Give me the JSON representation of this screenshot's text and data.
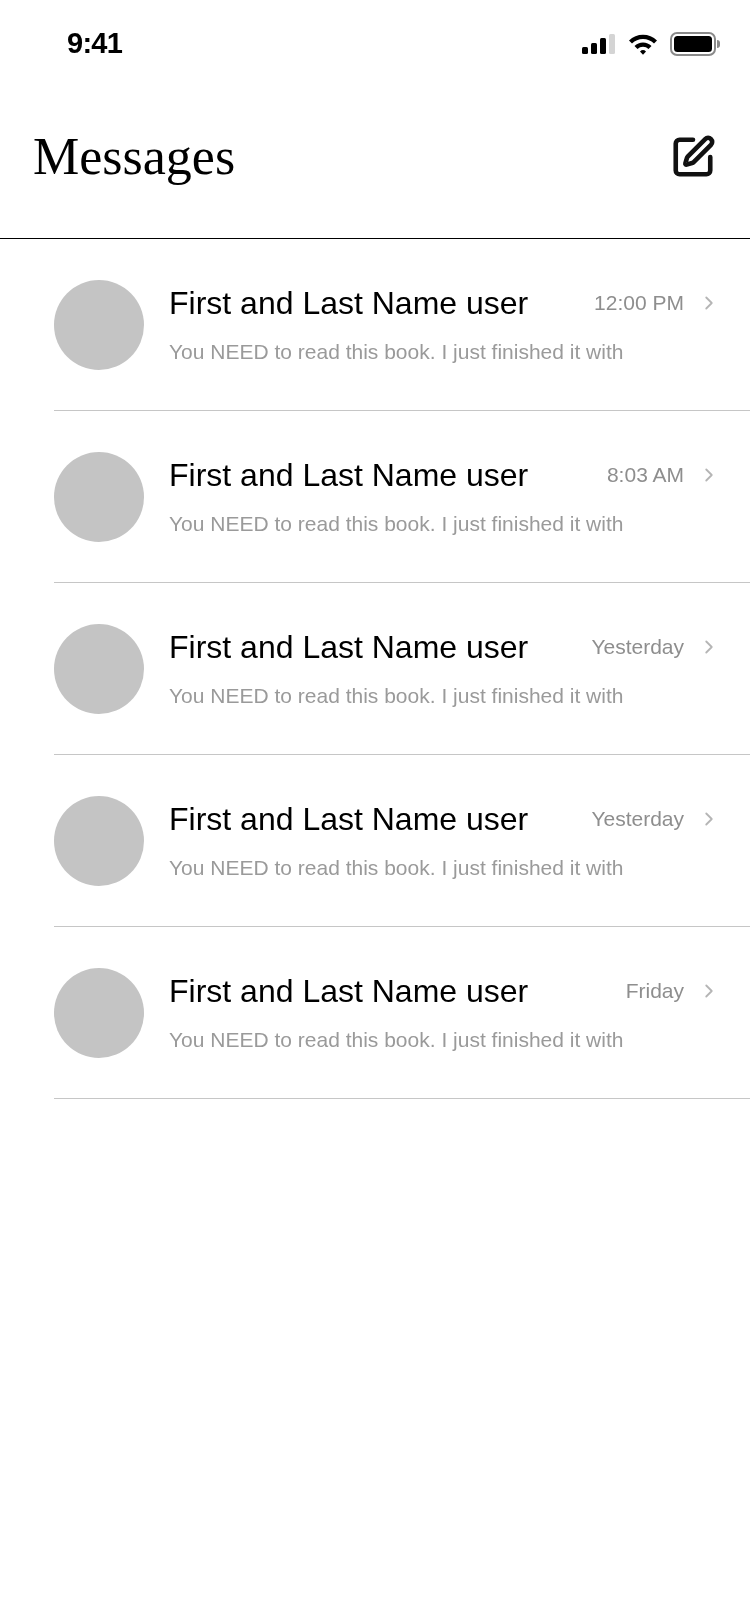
{
  "status_bar": {
    "time": "9:41"
  },
  "header": {
    "title": "Messages"
  },
  "conversations": [
    {
      "name": "First and Last Name user",
      "time": "12:00 PM",
      "preview": "You NEED to read this book. I just finished it with"
    },
    {
      "name": "First and Last Name user",
      "time": "8:03 AM",
      "preview": "You NEED to read this book. I just finished it with"
    },
    {
      "name": "First and Last Name user",
      "time": "Yesterday",
      "preview": "You NEED to read this book. I just finished it with"
    },
    {
      "name": "First and Last Name user",
      "time": "Yesterday",
      "preview": "You NEED to read this book. I just finished it with"
    },
    {
      "name": "First and Last Name user",
      "time": "Friday",
      "preview": "You NEED to read this book. I just finished it with"
    }
  ]
}
